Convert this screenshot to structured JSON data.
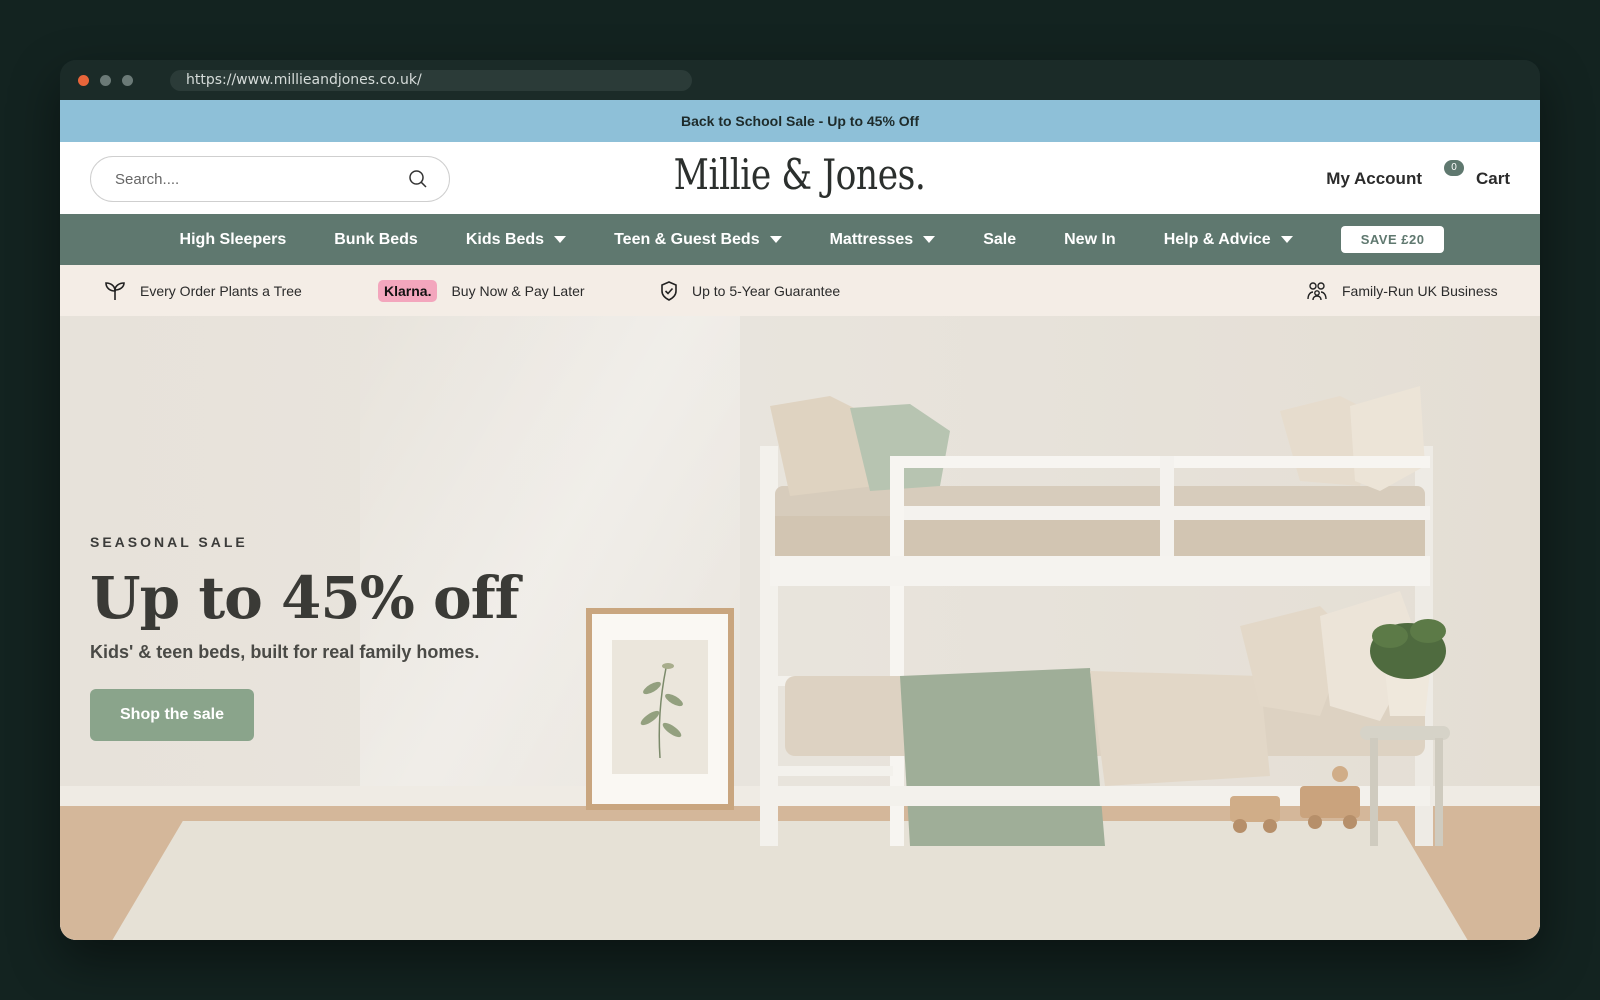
{
  "browser": {
    "url": "https://www.millieandjones.co.uk/"
  },
  "promo_bar": {
    "text": "Back to School Sale - Up to 45% Off"
  },
  "header": {
    "search_placeholder": "Search....",
    "logo_text": "Millie & Jones.",
    "account_label": "My Account",
    "cart_label": "Cart",
    "cart_count": "0"
  },
  "nav": {
    "items": [
      {
        "label": "High Sleepers",
        "dropdown": false
      },
      {
        "label": "Bunk Beds",
        "dropdown": false
      },
      {
        "label": "Kids Beds",
        "dropdown": true
      },
      {
        "label": "Teen & Guest Beds",
        "dropdown": true
      },
      {
        "label": "Mattresses",
        "dropdown": true
      },
      {
        "label": "Sale",
        "dropdown": false
      },
      {
        "label": "New In",
        "dropdown": false
      },
      {
        "label": "Help & Advice",
        "dropdown": true
      }
    ],
    "save_button": "SAVE £20"
  },
  "usp_bar": {
    "tree": "Every Order Plants a Tree",
    "klarna_badge": "Klarna.",
    "klarna_text": "Buy Now & Pay Later",
    "guarantee": "Up to 5-Year Guarantee",
    "family": "Family-Run UK Business"
  },
  "hero": {
    "eyebrow": "SEASONAL SALE",
    "headline": "Up to 45% off",
    "subline": "Kids' & teen beds, built for real family homes.",
    "cta": "Shop the sale"
  },
  "colors": {
    "promo": "#8ec0d8",
    "nav": "#5f786f",
    "usp": "#f4ede6",
    "cta": "#8aa48b",
    "klarna": "#f3a6bd"
  }
}
